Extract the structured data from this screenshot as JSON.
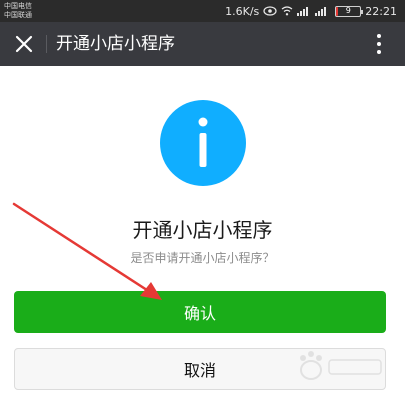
{
  "status_bar": {
    "carrier_1": "中国电信",
    "carrier_2": "中国联通",
    "network_speed": "1.6K/s",
    "battery_level_percent": 9,
    "battery_text": "9",
    "time": "22:21"
  },
  "title_bar": {
    "title": "开通小店小程序",
    "close_icon": "close-icon",
    "more_icon": "more-vertical-icon"
  },
  "dialog": {
    "icon": "info-icon",
    "title": "开通小店小程序",
    "subtitle": "是否申请开通小店小程序？",
    "confirm_label": "确认",
    "cancel_label": "取消"
  },
  "colors": {
    "accent_green": "#1aad19",
    "info_blue": "#10aeff",
    "titlebar_bg": "#393a3f",
    "annotation_red": "#e53935"
  }
}
